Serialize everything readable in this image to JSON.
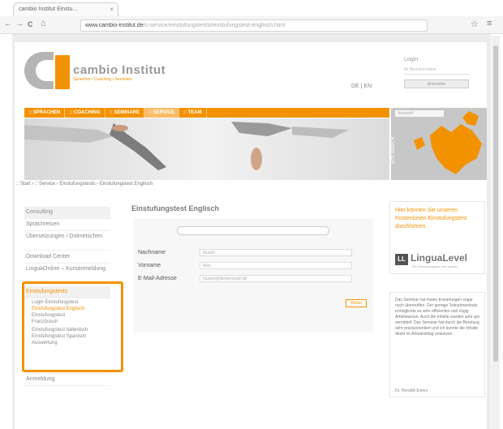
{
  "browser": {
    "tab_title": "cambio Institut Einstu...",
    "tab_close": "×",
    "back": "←",
    "forward": "→",
    "reload": "C",
    "home": "⌂",
    "url_host": "www.cambio-institut.de",
    "url_path": "/c-service/einstufungstests/einstufungstest-englisch.html",
    "star": "☆",
    "menu": "≡"
  },
  "header": {
    "logo_title": "cambio Institut",
    "logo_subtitle": "Sprachen • Coaching • Seminare",
    "lang_switch": "DE | EN",
    "login_title": "Login",
    "login_placeholder": "Ihr Benutzername",
    "login_button": "Anmelden"
  },
  "menu": [
    {
      "label": ":: SPRACHEN",
      "active": false
    },
    {
      "label": ":: COACHING",
      "active": false
    },
    {
      "label": ":: SEMINARE",
      "active": false
    },
    {
      "label": ":: SERVICE",
      "active": true
    },
    {
      "label": ":: TEAM",
      "active": false
    }
  ],
  "map": {
    "select_label": "Auswahl",
    "side_label": "SITE SEARCH"
  },
  "breadcrumb": ":: Start  ›  :: Service  ›  Einstufungstests  ›  Einstufungstest Englisch",
  "sidebar": {
    "items": [
      {
        "label": "Consulting",
        "grey": true
      },
      {
        "label": "Sprachreisen",
        "grey": false
      },
      {
        "label": "Übersetzungen / Dolmetschen",
        "grey": false
      },
      {
        "label": "Download Center",
        "grey": false
      },
      {
        "label": "LinguaOnline – Kursanmeldung",
        "grey": false
      },
      {
        "label": "Einstufungstests",
        "grey": true,
        "hl": true
      }
    ],
    "subitems": [
      {
        "label": "Login Einstufungstest",
        "hl": false
      },
      {
        "label": "Einstufungstest Englisch",
        "hl": true
      },
      {
        "label": "Einstufungstest Französisch",
        "hl": false
      },
      {
        "label": "Einstufungstest Italienisch",
        "hl": false
      },
      {
        "label": "Einstufungstest Spanisch",
        "hl": false
      },
      {
        "label": "Auswertung",
        "hl": false
      }
    ],
    "bottom": "Anmeldung"
  },
  "main": {
    "title": "Einstufungstest Englisch",
    "fields": [
      {
        "label": "Nachname",
        "value": "Muster"
      },
      {
        "label": "Vorname",
        "value": "Max"
      },
      {
        "label": "E-Mail-Adresse",
        "value": "muster@fitintermodel.de"
      }
    ],
    "next_button": "Weiter"
  },
  "right": {
    "promo": "Hier können Sie unseren Kostenlosen Einstufungstest durchführen.",
    "lingua_logo_icon": "LL",
    "lingua_logo": "LinguaLevel",
    "lingua_sub": "Der Einstufungstest von cambio",
    "quote": "Das Seminar hat meine Erwartungen sogar noch übertroffen. Der geringe Teilnehmerkreis ermöglichte es sehr effizientes und zügig Arbeitsweise. Auch die Inhalte wurden sehr gut vermittelt. Das Seminar hat durch die Beratung sehr praxisorientiert und ich konnte die Inhalte direkt im Arbeitsalltag umsetzen.",
    "quote_author": "Dr. Hendrik Ewers"
  },
  "colors": {
    "accent": "#f39200",
    "logo_grey": "#b5b5b5"
  }
}
